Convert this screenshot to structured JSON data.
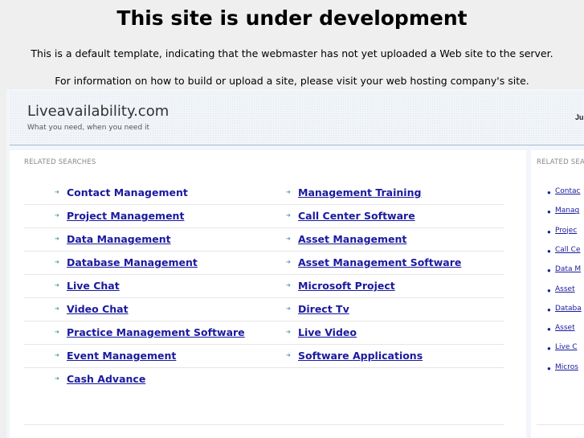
{
  "notice": {
    "title": "This site is under development",
    "line1": "This is a default template, indicating that the webmaster has not yet uploaded a Web site to the server.",
    "line2": "For information on how to build or upload a site, please visit your web hosting company's site."
  },
  "header": {
    "site_name": "Liveavailability.com",
    "tagline": "What you need, when you need it",
    "right_text": "Ju"
  },
  "main": {
    "section_title": "RELATED SEARCHES",
    "left_links": [
      {
        "label": "Contact Management",
        "underlined": false
      },
      {
        "label": "Project Management",
        "underlined": true
      },
      {
        "label": "Data Management",
        "underlined": true
      },
      {
        "label": "Database Management",
        "underlined": true
      },
      {
        "label": "Live Chat",
        "underlined": true
      },
      {
        "label": "Video Chat",
        "underlined": true
      },
      {
        "label": "Practice Management Software",
        "underlined": true
      },
      {
        "label": "Event Management",
        "underlined": true
      },
      {
        "label": "Cash Advance",
        "underlined": true
      }
    ],
    "right_links": [
      {
        "label": "Management Training",
        "underlined": true
      },
      {
        "label": "Call Center Software",
        "underlined": true
      },
      {
        "label": "Asset Management",
        "underlined": true
      },
      {
        "label": "Asset Management Software",
        "underlined": true
      },
      {
        "label": "Microsoft Project",
        "underlined": true
      },
      {
        "label": "Direct Tv",
        "underlined": true
      },
      {
        "label": "Live Video",
        "underlined": true
      },
      {
        "label": "Software Applications",
        "underlined": true
      }
    ]
  },
  "side": {
    "section_title": "RELATED SEA",
    "links": [
      "Contac",
      "Manag",
      "Projec",
      "Call Ce",
      "Data M",
      "Asset",
      "Databa",
      "Asset",
      "Live C",
      "Micros"
    ]
  },
  "colors": {
    "link": "#1a1a9e",
    "arrow": "#3a8f9a",
    "header_border": "#9fbbd4"
  }
}
